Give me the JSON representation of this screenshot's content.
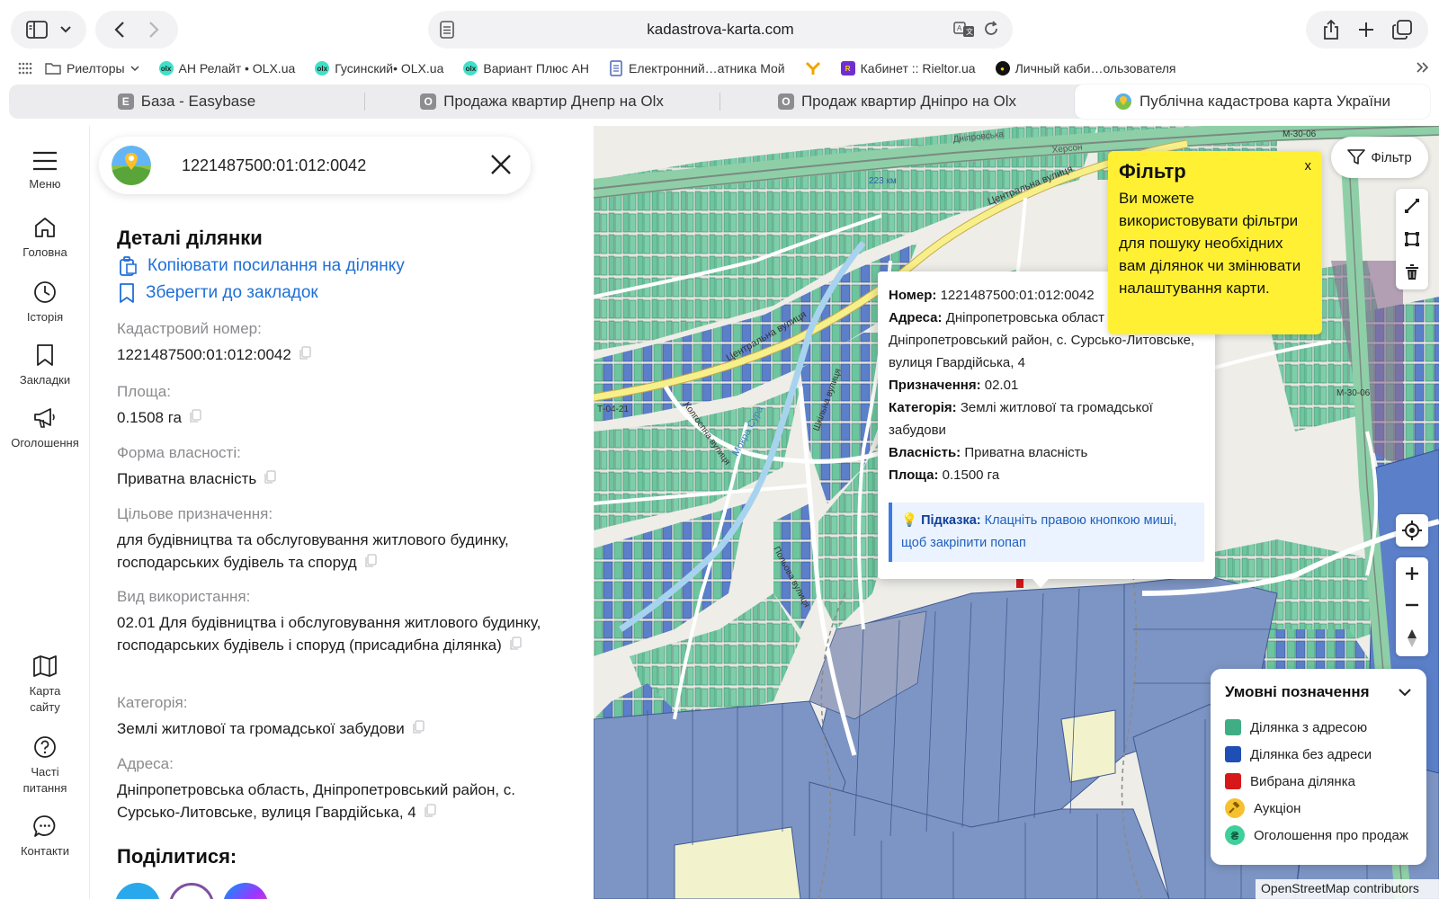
{
  "browser": {
    "url": "kadastrova-karta.com",
    "bookmarks": [
      {
        "label": "Риелторы",
        "icon": "folder-icon"
      },
      {
        "label": "АН Релайт • OLX.ua",
        "icon": "olx-icon"
      },
      {
        "label": "Гусинский• OLX.ua",
        "icon": "olx-icon"
      },
      {
        "label": "Вариант Плюс АН",
        "icon": "olx-icon"
      },
      {
        "label": "Електронний…атника Мой",
        "icon": "document-icon"
      },
      {
        "label": "",
        "icon": "yellow-logo-icon"
      },
      {
        "label": "Кабинет :: Rieltor.ua",
        "icon": "rieltor-icon"
      },
      {
        "label": "Личный каби…ользователя",
        "icon": "circle-logo-icon"
      }
    ],
    "tabs": [
      {
        "label": "База - Easybase",
        "favicon": "E"
      },
      {
        "label": "Продажа квартир Днепр на Olx",
        "favicon": "O"
      },
      {
        "label": "Продаж квартир Дніпро на Olx",
        "favicon": "O"
      },
      {
        "label": "Публічна кадастрова карта України",
        "favicon": ""
      }
    ]
  },
  "rail": {
    "menu": "Меню",
    "home": "Головна",
    "history": "Історія",
    "bookmarks": "Закладки",
    "ads": "Оголошення",
    "sitemap": "Карта сайту",
    "faq": "Часті питання",
    "contacts": "Контакти"
  },
  "search": {
    "value": "1221487500:01:012:0042"
  },
  "details": {
    "title": "Деталі ділянки",
    "copy_link": "Копіювати посилання на ділянку",
    "save_bookmark": "Зберегти до закладок",
    "fields": [
      {
        "label": "Кадастровий номер:",
        "value": "1221487500:01:012:0042"
      },
      {
        "label": "Площа:",
        "value": "0.1508 га"
      },
      {
        "label": "Форма власності:",
        "value": "Приватна власність"
      },
      {
        "label": "Цільове призначення:",
        "value": "для будівництва та обслуговування житлового будинку, господарських будівель та споруд"
      },
      {
        "label": "Вид використання:",
        "value": "02.01 Для будівництва і обслуговування житлового будинку, господарських будівель і споруд (присадибна ділянка)"
      },
      {
        "label": "Категорія:",
        "value": "Землі житлової та громадської забудови"
      },
      {
        "label": "Адреса:",
        "value": "Дніпропетровська область, Дніпропетровський район, с. Сурсько-Литовське, вулиця Гвардійська, 4"
      }
    ],
    "share_title": "Поділитися:"
  },
  "popup": {
    "number_label": "Номер:",
    "number": "1221487500:01:012:0042",
    "address_label": "Адреса:",
    "address": "Дніпропетровська област Дніпропетровський район, с. Сурсько-Литовське, вулиця Гвардійська, 4",
    "purpose_label": "Призначення:",
    "purpose": "02.01",
    "category_label": "Категорія:",
    "category": "Землі житлової та громадської забудови",
    "ownership_label": "Власність:",
    "ownership": "Приватна власність",
    "area_label": "Площа:",
    "area": "0.1500 га",
    "hint_label": "Підказка:",
    "hint": "Клацніть правою кнопкою миші, щоб закріпити попап"
  },
  "tip": {
    "title": "Фільтр",
    "text": "Ви можете використовувати фільтри для пошуку необхідних вам ділянок чи змінювати налаштування карти.",
    "close": "x"
  },
  "filter_button": "Фільтр",
  "map_labels": {
    "road_central": "Центральна вулиця",
    "road_central_2": "Центральна вулиця",
    "km": "223 км",
    "t0421": "Т-04-21",
    "m3006": "М-30-06",
    "river": "Мокра Сура",
    "street_1": "Колгоспна вулиця",
    "street_2": "Шкільна вулиця",
    "street_3": "Польова вулиця",
    "rail_1": "Дніпровська",
    "rail_2": "Херсон"
  },
  "legend": {
    "title": "Умовні позначення",
    "items": [
      {
        "label": "Ділянка з адресою",
        "color": "#3fae85"
      },
      {
        "label": "Ділянка без адреси",
        "color": "#1f4fb5"
      },
      {
        "label": "Вибрана ділянка",
        "color": "#d71818"
      },
      {
        "label": "Аукціон",
        "icon": "hammer-icon",
        "color": "#f5c12e"
      },
      {
        "label": "Оголошення про продаж",
        "icon": "hryvnia-icon",
        "symbol": "₴",
        "color": "#3fcf9b"
      }
    ]
  },
  "attribution": "OpenStreetMap contributors",
  "colors": {
    "parcel_addr": "#6cc59e",
    "parcel_noaddr": "#5b7fc9",
    "field_parcel": "#7d95c4",
    "road_yellow": "#f7f08a",
    "link_blue": "#1f6fd6",
    "tip_yellow": "#fff033"
  }
}
